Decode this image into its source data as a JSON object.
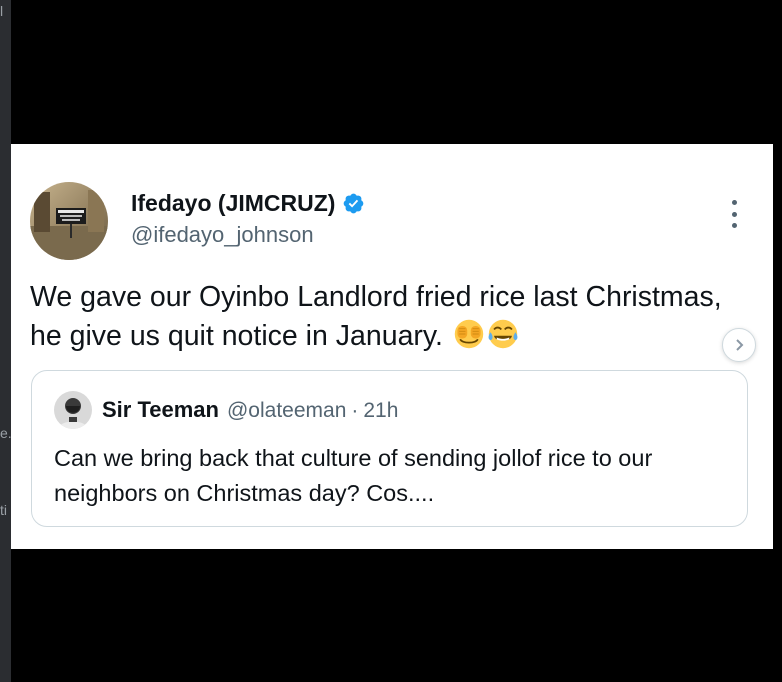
{
  "tweet": {
    "author_name": "Ifedayo (JIMCRUZ)",
    "author_handle": "@ifedayo_johnson",
    "text": "We gave our Oyinbo Landlord fried rice last Christmas, he give us quit notice in January.",
    "emojis": [
      "face-with-hands-over-eyes-icon",
      "tears-of-joy-icon"
    ],
    "verified": true
  },
  "quoted_tweet": {
    "author_name": "Sir Teeman",
    "author_handle": "@olateeman",
    "separator": "·",
    "time": "21h",
    "text": "Can we bring back that culture of sending jollof rice to our neighbors on Christmas day? Cos...."
  },
  "background_fragments": {
    "top": "l",
    "middle": "e.",
    "lower": "ti"
  },
  "colors": {
    "background": "#000000",
    "card": "#ffffff",
    "text_primary": "#0f1419",
    "text_secondary": "#536471",
    "verified_blue": "#1d9bf0",
    "border": "#cfd9de"
  }
}
